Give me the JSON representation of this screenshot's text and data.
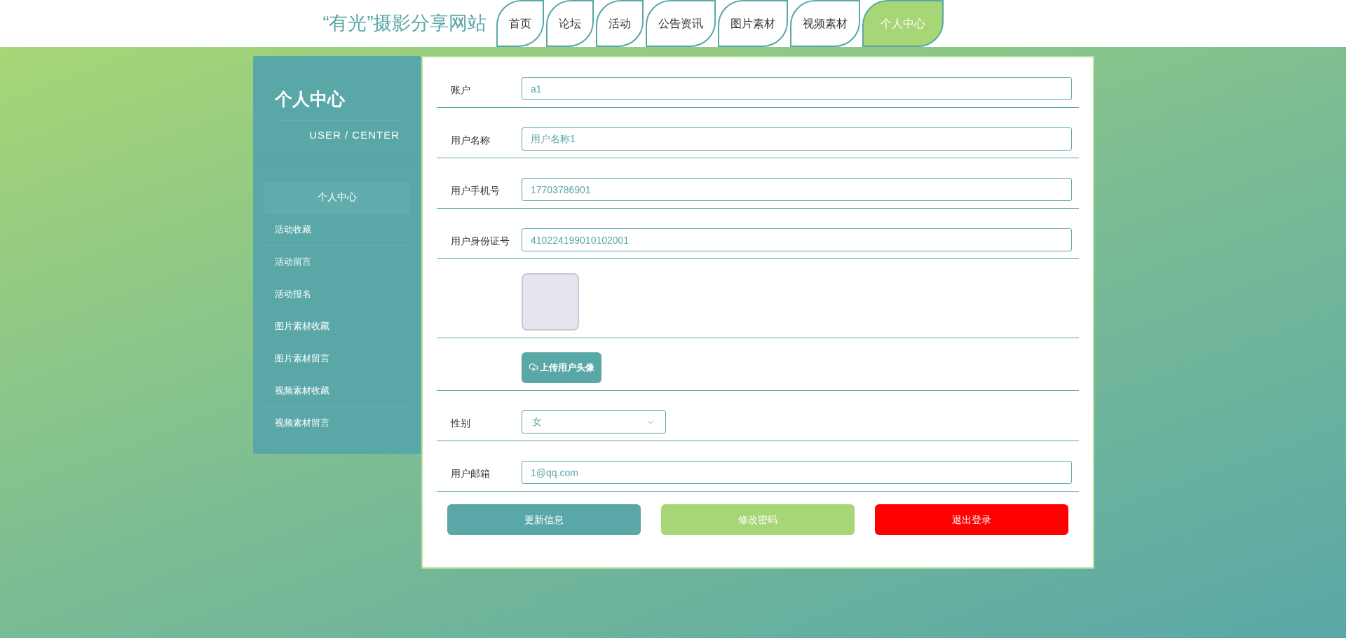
{
  "header": {
    "site_title": "“有光”摄影分享网站",
    "nav_tabs": [
      {
        "label": "首页",
        "selected": false
      },
      {
        "label": "论坛",
        "selected": false
      },
      {
        "label": "活动",
        "selected": false
      },
      {
        "label": "公告资讯",
        "selected": false
      },
      {
        "label": "图片素材",
        "selected": false
      },
      {
        "label": "视频素材",
        "selected": false
      },
      {
        "label": "个人中心",
        "selected": true
      }
    ]
  },
  "sidebar": {
    "title": "个人中心",
    "subtitle": "USER / CENTER",
    "items": [
      {
        "label": "个人中心",
        "selected": true
      },
      {
        "label": "活动收藏",
        "selected": false
      },
      {
        "label": "活动留言",
        "selected": false
      },
      {
        "label": "活动报名",
        "selected": false
      },
      {
        "label": "图片素材收藏",
        "selected": false
      },
      {
        "label": "图片素材留言",
        "selected": false
      },
      {
        "label": "视频素材收藏",
        "selected": false
      },
      {
        "label": "视频素材留言",
        "selected": false
      }
    ]
  },
  "form": {
    "rows": [
      {
        "kind": "input",
        "label": "账户",
        "value": "a1"
      },
      {
        "kind": "input",
        "label": "用户名称",
        "value": "用户名称1"
      },
      {
        "kind": "input",
        "label": "用户手机号",
        "value": "17703786901"
      },
      {
        "kind": "input",
        "label": "用户身份证号",
        "value": "410224199010102001"
      },
      {
        "kind": "avatar"
      },
      {
        "kind": "upload",
        "button": "上传用户头像"
      },
      {
        "kind": "select",
        "label": "性别",
        "value": "女"
      },
      {
        "kind": "input",
        "label": "用户邮箱",
        "value": "1@qq.com"
      }
    ],
    "buttons": [
      {
        "label": "更新信息",
        "color": "#5aa7a7"
      },
      {
        "label": "修改密码",
        "color": "#a7d676"
      },
      {
        "label": "退出登录",
        "color": "#ff0000"
      }
    ]
  }
}
